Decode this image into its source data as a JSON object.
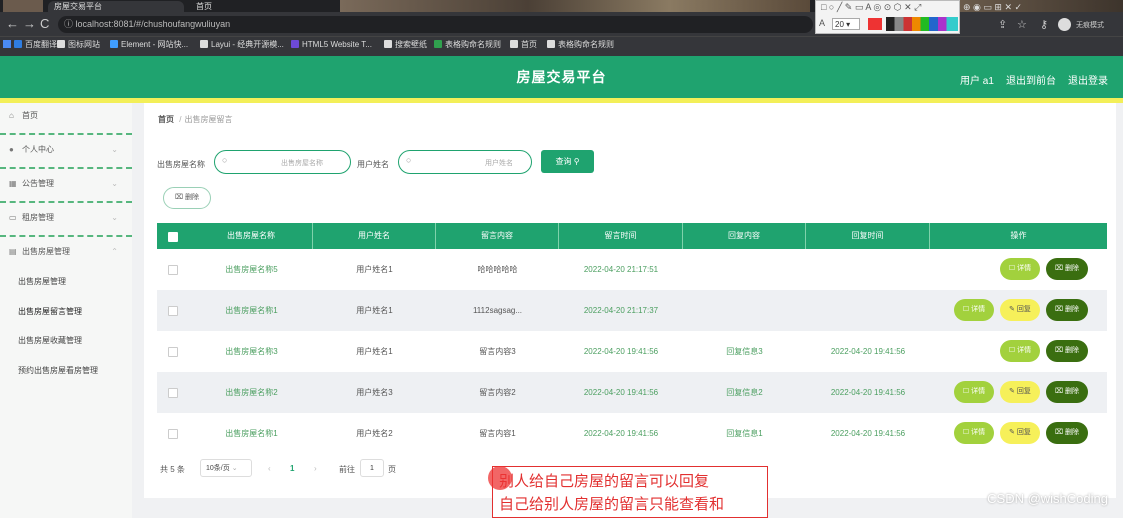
{
  "browser": {
    "tabs": [
      {
        "title": "房屋交易平台"
      },
      {
        "title": "首页"
      }
    ],
    "url": "localhost:8081/#/chushoufangwuliuyan",
    "bookmarks": [
      {
        "label": "百度翻译",
        "color": "#2f7de1"
      },
      {
        "label": "图标网站",
        "color": "#dddddd"
      },
      {
        "label": "Element - 网站快...",
        "color": "#409eff"
      },
      {
        "label": "Layui - 经典开源模...",
        "color": "#dddddd"
      },
      {
        "label": "HTML5 Website T...",
        "color": "#6d4ad6"
      },
      {
        "label": "搜索壁纸",
        "color": "#dddddd"
      },
      {
        "label": "表格购命名规则",
        "color": "#30a14e"
      },
      {
        "label": "首页",
        "color": "#dddddd"
      },
      {
        "label": "表格购命名规则",
        "color": "#dddddd"
      }
    ],
    "zoom_value": "20"
  },
  "header": {
    "title": "房屋交易平台",
    "user": "用户 a1",
    "back_to_home": "退出到前台",
    "logout": "退出登录"
  },
  "sidebar": {
    "items": [
      {
        "label": "首页",
        "icon": "home-icon"
      },
      {
        "label": "个人中心",
        "icon": "user-icon"
      },
      {
        "label": "公告管理",
        "icon": "calendar-icon"
      },
      {
        "label": "租房管理",
        "icon": "chat-icon"
      },
      {
        "label": "出售房屋管理",
        "icon": "grid-icon"
      }
    ],
    "subitems": [
      "出售房屋管理",
      "出售房屋留言管理",
      "出售房屋收藏管理",
      "预约出售房屋看房管理"
    ]
  },
  "breadcrumb": {
    "home": "首页",
    "separator": "/",
    "current": "出售房屋留言"
  },
  "search": {
    "label1": "出售房屋名称",
    "placeholder1": "出售房屋名称",
    "label2": "用户姓名",
    "placeholder2": "用户姓名",
    "query_button": "查询"
  },
  "toolbar": {
    "delete_button": "删除"
  },
  "table": {
    "headers": [
      "出售房屋名称",
      "用户姓名",
      "留言内容",
      "留言时间",
      "回复内容",
      "回复时间",
      "操作"
    ],
    "rows": [
      {
        "house": "出售房屋名称5",
        "user": "用户姓名1",
        "content": "哈哈哈哈哈",
        "time": "2022-04-20 21:17:51",
        "reply": "",
        "reply_time": "",
        "ops": [
          "详情",
          "删除"
        ]
      },
      {
        "house": "出售房屋名称1",
        "user": "用户姓名1",
        "content": "1112sagsag...",
        "time": "2022-04-20 21:17:37",
        "reply": "",
        "reply_time": "",
        "ops": [
          "详情",
          "回复",
          "删除"
        ]
      },
      {
        "house": "出售房屋名称3",
        "user": "用户姓名1",
        "content": "留言内容3",
        "time": "2022-04-20 19:41:56",
        "reply": "回复信息3",
        "reply_time": "2022-04-20 19:41:56",
        "ops": [
          "详情",
          "删除"
        ]
      },
      {
        "house": "出售房屋名称2",
        "user": "用户姓名3",
        "content": "留言内容2",
        "time": "2022-04-20 19:41:56",
        "reply": "回复信息2",
        "reply_time": "2022-04-20 19:41:56",
        "ops": [
          "详情",
          "回复",
          "删除"
        ]
      },
      {
        "house": "出售房屋名称1",
        "user": "用户姓名2",
        "content": "留言内容1",
        "time": "2022-04-20 19:41:56",
        "reply": "回复信息1",
        "reply_time": "2022-04-20 19:41:56",
        "ops": [
          "详情",
          "回复",
          "删除"
        ]
      }
    ]
  },
  "pagination": {
    "total": "共 5 条",
    "page_size": "10条/页",
    "prev": "‹",
    "current_page": "1",
    "next": "›",
    "goto": "前往",
    "goto_value": "1",
    "page_unit": "页"
  },
  "annotation": {
    "line1": "别人给自己房屋的留言可以回复",
    "line2": "自己给别人房屋的留言只能查看和"
  },
  "watermark": "CSDN @wishCoding",
  "colors": {
    "primary": "#1fa36f",
    "yellow_strip": "#f3ef58",
    "detail_btn": "#a2d13d",
    "reply_btn": "#f6f05a",
    "delete_btn": "#3a6e10",
    "annotation": "#e23030"
  }
}
